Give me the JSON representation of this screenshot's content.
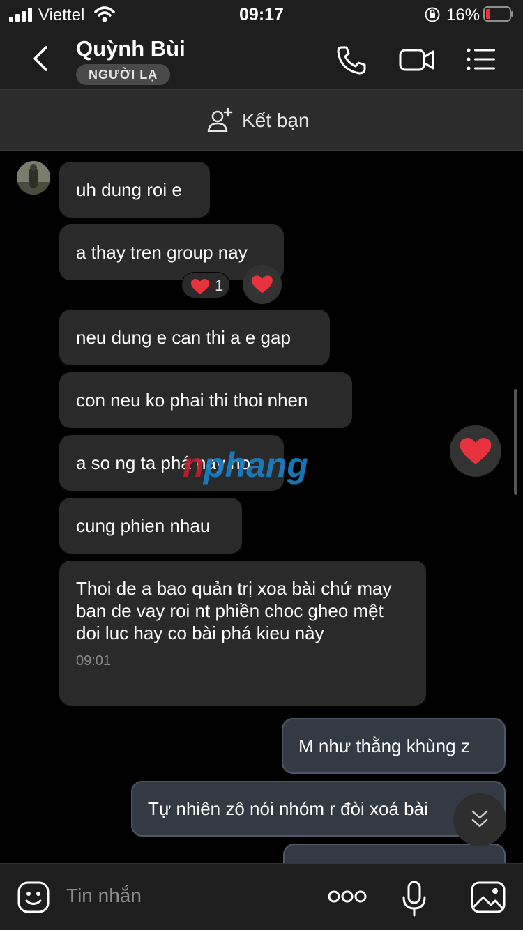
{
  "status_bar": {
    "carrier": "Viettel",
    "time": "09:17",
    "battery": "16%"
  },
  "header": {
    "contact_name": "Quỳnh Bùi",
    "stranger_badge": "NGƯỜI LẠ",
    "icons": [
      "back-icon",
      "phone-icon",
      "video-call-icon",
      "menu-list-icon"
    ]
  },
  "friend_bar": {
    "label": "Kết bạn",
    "icon": "add-friend-icon"
  },
  "messages": [
    {
      "side": "in",
      "text": "uh dung roi e"
    },
    {
      "side": "in",
      "text": "a thay tren group nay",
      "reaction_count": "1"
    },
    {
      "side": "in",
      "text": "neu dung e can thi a e gap"
    },
    {
      "side": "in",
      "text": "con neu ko phai thi thoi nhen"
    },
    {
      "side": "in",
      "text": "a so ng ta phá nay no"
    },
    {
      "side": "in",
      "text": "cung phien nhau"
    },
    {
      "side": "in",
      "text": "Thoi de a bao quản trị xoa bài chứ may ban de vay roi nt phiền choc gheo mệt doi luc hay co bài phá kieu này",
      "time": "09:01"
    },
    {
      "side": "out",
      "text": "M như thằng khùng z"
    },
    {
      "side": "out",
      "text": "Tự nhiên zô nói nhóm r đòi xoá bài"
    }
  ],
  "watermark": "nphang",
  "composer": {
    "placeholder": "Tin nhắn",
    "icons": [
      "emoji-icon",
      "more-icon",
      "microphone-icon",
      "photo-icon"
    ]
  },
  "colors": {
    "background": "#000000",
    "bar": "#1e1e1e",
    "incoming_bubble": "#2a2a2a",
    "outgoing_bubble": "#333a44",
    "heart": "#e8323c"
  }
}
